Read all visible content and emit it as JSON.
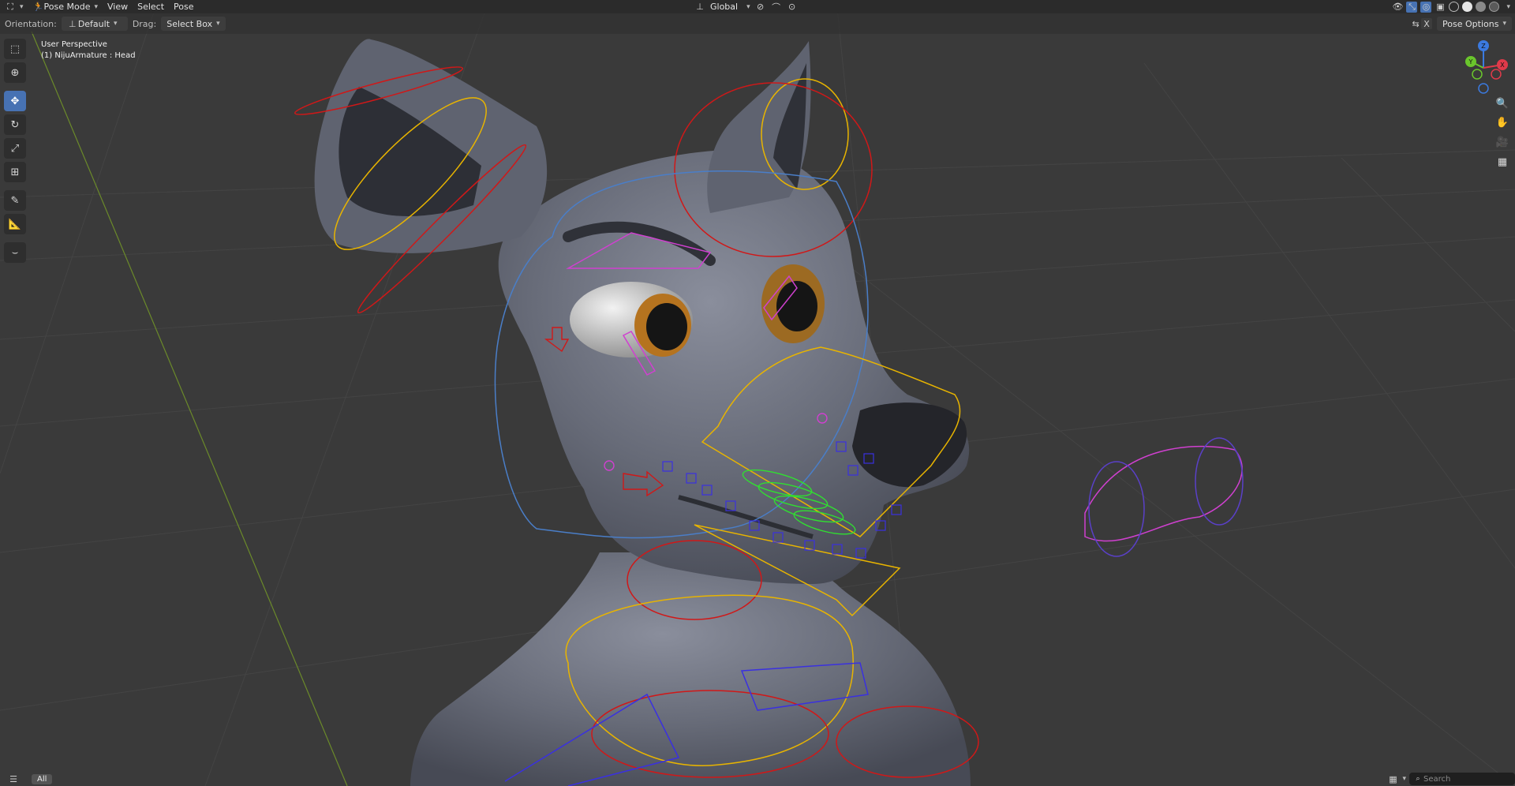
{
  "header": {
    "mode": "Pose Mode",
    "menus": [
      "View",
      "Select",
      "Pose"
    ],
    "transform_orientation": "Global",
    "pose_options": "Pose Options"
  },
  "tool_header": {
    "orientation_label": "Orientation:",
    "orientation_value": "Default",
    "drag_label": "Drag:",
    "drag_value": "Select Box"
  },
  "viewport": {
    "view_name": "User Perspective",
    "active_bone": "(1) NijuArmature : Head"
  },
  "gizmo": {
    "z": "Z",
    "y": "Y",
    "x": "X"
  },
  "toolbar": {
    "tools": [
      "select-box",
      "cursor",
      "move",
      "rotate",
      "scale",
      "transform",
      "annotate",
      "measure",
      "relax-pose"
    ],
    "active": "move"
  },
  "status": {
    "all_label": "All",
    "search_placeholder": "Search"
  },
  "colors": {
    "active_tool": "#4772b3",
    "bone_yellow": "#e8b400",
    "bone_red": "#e01020",
    "bone_blue": "#3a30e0",
    "bone_magenta": "#d040d0",
    "bone_green": "#30e030",
    "mesh": "#6b6f7c"
  }
}
